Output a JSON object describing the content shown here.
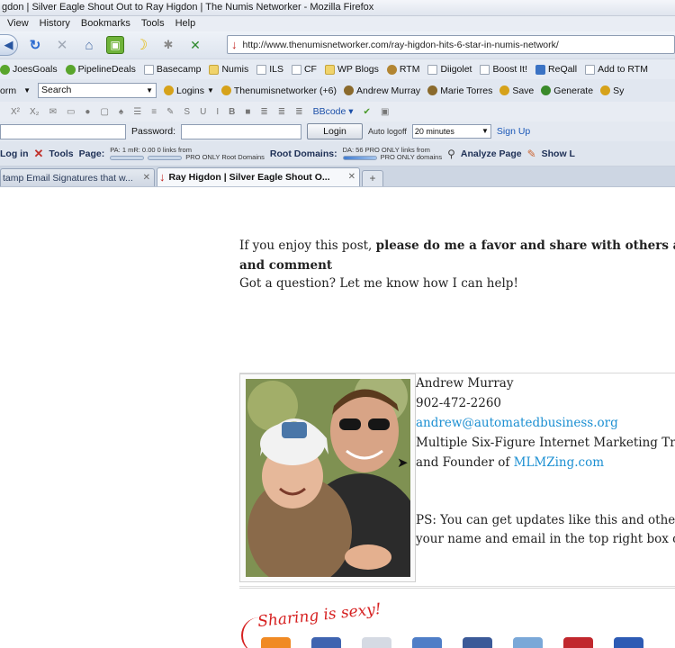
{
  "window_title": "gdon | Silver Eagle Shout Out to Ray Higdon | The Numis Networker - Mozilla Firefox",
  "menu": [
    "View",
    "History",
    "Bookmarks",
    "Tools",
    "Help"
  ],
  "url": "http://www.thenumisnetworker.com/ray-higdon-hits-6-star-in-numis-network/",
  "bookmarks": [
    "JoesGoals",
    "PipelineDeals",
    "Basecamp",
    "Numis",
    "ILS",
    "CF",
    "WP Blogs",
    "RTM",
    "Diigolet",
    "Boost It!",
    "ReQall",
    "Add to RTM"
  ],
  "toolbar3": {
    "form_label": "orm",
    "search_placeholder": "Search",
    "logins": "Logins",
    "site": "Thenumisnetworker (+6)",
    "user1": "Andrew Murray",
    "user2": "Marie Torres",
    "save": "Save",
    "generate": "Generate",
    "trail": "Sy"
  },
  "toolbar4": {
    "bbcode": "BBcode"
  },
  "toolbar5": {
    "password_label": "Password:",
    "login_button": "Login",
    "auto_logoff": "Auto logoff",
    "logoff_value": "20 minutes",
    "signup": "Sign Up"
  },
  "toolbar6": {
    "login": "Log in",
    "tools": "Tools",
    "page": "Page:",
    "pa_mr_line": "PA: 1     mR: 0.00   0 links from",
    "pro_root": "PRO ONLY Root Domains",
    "root_domains": "Root Domains:",
    "da_line": "DA: 56    PRO ONLY links from",
    "pro_domains": "PRO ONLY domains",
    "analyze": "Analyze Page",
    "show": "Show L"
  },
  "tabs": [
    {
      "label": "tamp Email Signatures that w...",
      "active": false
    },
    {
      "label": "Ray Higdon | Silver Eagle Shout O...",
      "active": true
    }
  ],
  "content": {
    "intro_normal": "If you enjoy this post, ",
    "intro_bold": "please do me a favor and share with others an",
    "intro_bold2": "and comment",
    "question": "Got a question? Let me know how I can help!",
    "sig_name": "Andrew Murray",
    "sig_phone": "902-472-2260",
    "sig_email": "andrew@automatedbusiness.org",
    "sig_title": "Multiple Six-Figure Internet Marketing Trai",
    "sig_founder_prefix": "and Founder of ",
    "sig_founder_link": "MLMZing.com",
    "ps_line1": "PS: You can get updates like this and others l",
    "ps_line2": "your name and email in the top right box of n",
    "sharing": "Sharing is sexy!"
  }
}
